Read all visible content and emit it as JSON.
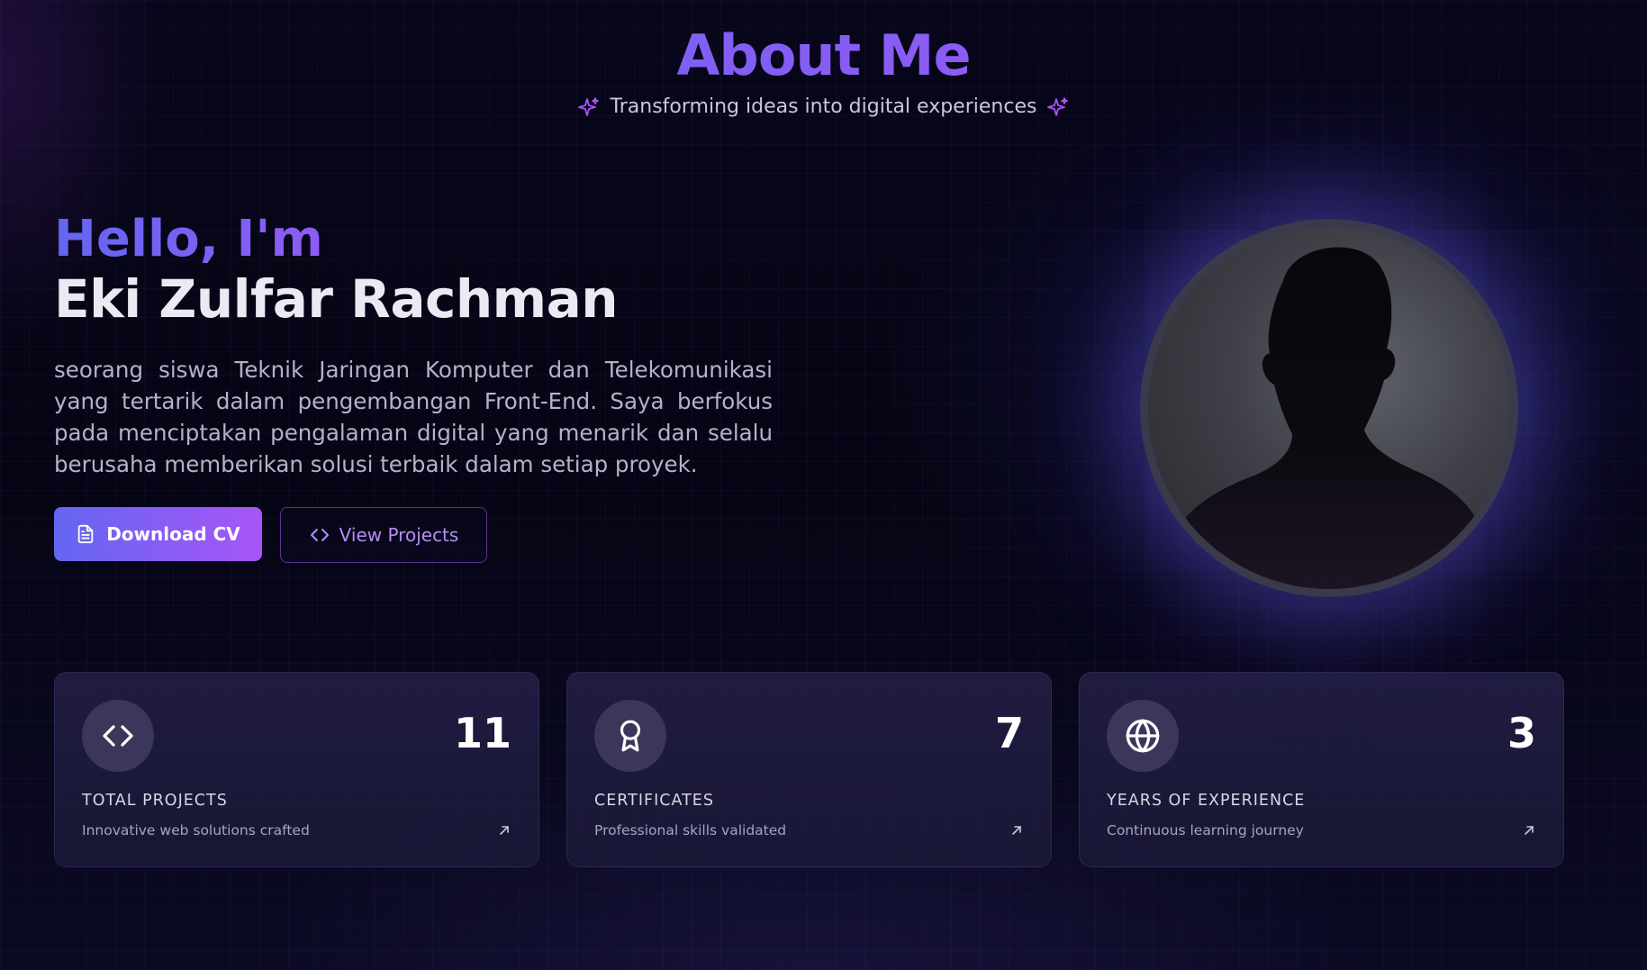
{
  "header": {
    "title": "About Me",
    "subtitle": "Transforming ideas into digital experiences"
  },
  "intro": {
    "greeting": "Hello, I'm",
    "name": "Eki Zulfar Rachman",
    "bio": "seorang siswa Teknik Jaringan Komputer dan Telekomunikasi yang tertarik dalam pengembangan Front-End. Saya berfokus pada menciptakan pengalaman digital yang menarik dan selalu berusaha memberikan solusi terbaik dalam setiap proyek."
  },
  "buttons": {
    "download_cv": "Download CV",
    "view_projects": "View Projects"
  },
  "stats": [
    {
      "icon": "code-icon",
      "value": "11",
      "label": "TOTAL PROJECTS",
      "description": "Innovative web solutions crafted"
    },
    {
      "icon": "award-icon",
      "value": "7",
      "label": "CERTIFICATES",
      "description": "Professional skills validated"
    },
    {
      "icon": "globe-icon",
      "value": "3",
      "label": "YEARS OF EXPERIENCE",
      "description": "Continuous learning journey"
    }
  ],
  "colors": {
    "accent_start": "#6366f1",
    "accent_end": "#a855f7",
    "background": "#05040f"
  }
}
